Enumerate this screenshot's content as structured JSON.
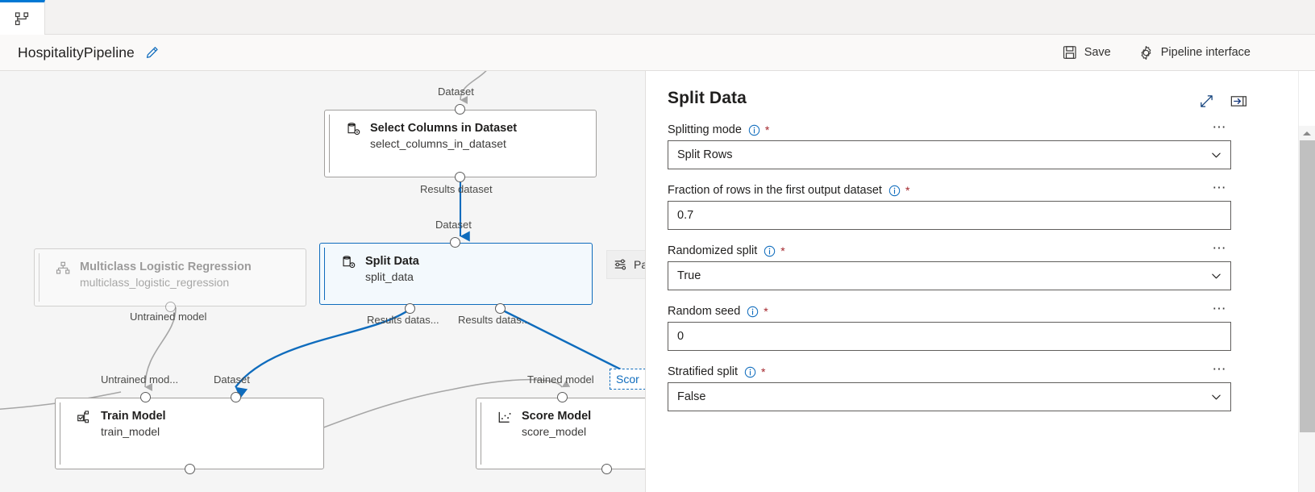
{
  "tabstrip": {
    "active_tab_icon": "pipeline-graph-icon"
  },
  "titlebar": {
    "pipeline_name": "HospitalityPipeline",
    "edit_icon": "pencil-icon",
    "save_label": "Save",
    "save_icon": "floppy-disk-icon",
    "pipeline_interface_label": "Pipeline interface",
    "pipeline_interface_icon": "gear-icon"
  },
  "canvas": {
    "nodes": [
      {
        "title": "Select Columns in Dataset",
        "subtitle": "select_columns_in_dataset",
        "icon": "dataset-gear-icon",
        "state": "normal"
      },
      {
        "title": "Multiclass Logistic Regression",
        "subtitle": "multiclass_logistic_regression",
        "icon": "model-branch-icon",
        "state": "faded"
      },
      {
        "title": "Split Data",
        "subtitle": "split_data",
        "icon": "dataset-gear-icon",
        "state": "selected"
      },
      {
        "title": "Train Model",
        "subtitle": "train_model",
        "icon": "train-model-icon",
        "state": "normal"
      },
      {
        "title": "Score Model",
        "subtitle": "score_model",
        "icon": "score-model-icon",
        "state": "normal"
      }
    ],
    "port_labels": {
      "select_in": "Dataset",
      "select_out": "Results dataset",
      "split_in": "Dataset",
      "split_out_left": "Results datas...",
      "split_out_right": "Results datas...",
      "mlr_out": "Untrained model",
      "train_in_left": "Untrained mod...",
      "train_in_right": "Dataset",
      "score_in_left": "Trained model"
    },
    "node_toolchip": {
      "label": "Pa",
      "icon": "sliders-icon"
    },
    "drag_ghost": {
      "label": "Scor"
    },
    "accent_color": "#0f6cbd",
    "edge_color_active": "#0f6cbd",
    "edge_color_idle": "#a6a6a6"
  },
  "panel": {
    "title": "Split Data",
    "expand_icon": "expand-diagonal-icon",
    "collapse_icon": "collapse-panel-icon",
    "more_glyph": "⋯",
    "fields": [
      {
        "label": "Splitting mode",
        "value": "Split Rows",
        "type": "select",
        "required": true,
        "info_icon": "info-circle-icon"
      },
      {
        "label": "Fraction of rows in the first output dataset",
        "value": "0.7",
        "type": "text",
        "required": true,
        "info_icon": "info-circle-icon"
      },
      {
        "label": "Randomized split",
        "value": "True",
        "type": "select",
        "required": true,
        "info_icon": "info-circle-icon"
      },
      {
        "label": "Random seed",
        "value": "0",
        "type": "text",
        "required": true,
        "info_icon": "info-circle-icon"
      },
      {
        "label": "Stratified split",
        "value": "False",
        "type": "select",
        "required": true,
        "info_icon": "info-circle-icon"
      }
    ]
  },
  "scrollbar": {
    "up_arrow_icon": "scroll-up-arrow-icon"
  }
}
